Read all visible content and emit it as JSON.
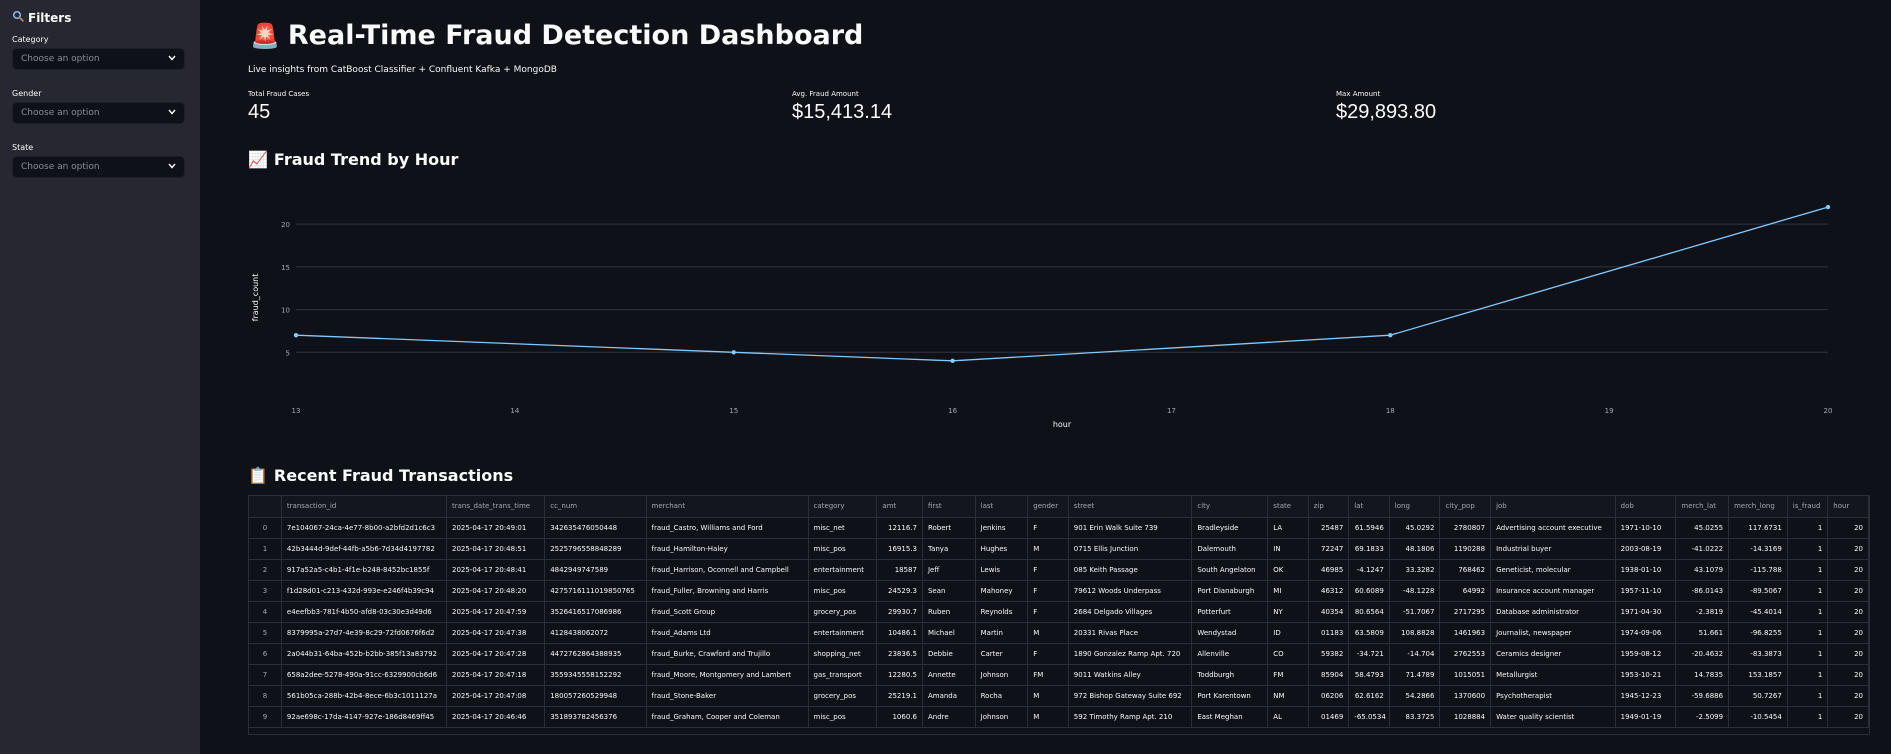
{
  "sidebar": {
    "title": "Filters",
    "title_icon": "magnifier-icon",
    "filters": [
      {
        "label": "Category",
        "placeholder": "Choose an option"
      },
      {
        "label": "Gender",
        "placeholder": "Choose an option"
      },
      {
        "label": "State",
        "placeholder": "Choose an option"
      }
    ]
  },
  "header": {
    "title": "Real-Time Fraud Detection Dashboard",
    "title_icon": "🚨",
    "subtitle": "Live insights from CatBoost Classifier + Confluent Kafka + MongoDB"
  },
  "metrics": [
    {
      "label": "Total Fraud Cases",
      "value": "45"
    },
    {
      "label": "Avg. Fraud Amount",
      "value": "$15,413.14"
    },
    {
      "label": "Max Amount",
      "value": "$29,893.80"
    }
  ],
  "trend_section": {
    "title": "Fraud Trend by Hour",
    "icon": "📈"
  },
  "chart_data": {
    "type": "line",
    "x": [
      13,
      16,
      15,
      18,
      20
    ],
    "y": [
      7,
      4,
      5,
      7,
      22
    ],
    "xticks": [
      "13",
      "14",
      "15",
      "16",
      "17",
      "18",
      "19",
      "20"
    ],
    "yticks": [
      "5",
      "10",
      "15",
      "20"
    ],
    "xlabel": "hour",
    "ylabel": "fraud_count",
    "xlim": [
      13,
      20
    ],
    "ylim": [
      0,
      24
    ],
    "grid": true,
    "line_color": "#83c9ff"
  },
  "table_section": {
    "title": "Recent Fraud Transactions",
    "icon": "📋"
  },
  "table": {
    "columns": [
      "",
      "transaction_id",
      "trans_date_trans_time",
      "cc_num",
      "merchant",
      "category",
      "amt",
      "first",
      "last",
      "gender",
      "street",
      "city",
      "state",
      "zip",
      "lat",
      "long",
      "city_pop",
      "job",
      "dob",
      "merch_lat",
      "merch_long",
      "is_fraud",
      "hour"
    ],
    "rows": [
      [
        "0",
        "7e104067-24ca-4e77-8b00-a2bfd2d1c6c3",
        "2025-04-17 20:49:01",
        "342635476050448",
        "fraud_Castro, Williams and Ford",
        "misc_net",
        "12116.7",
        "Robert",
        "Jenkins",
        "F",
        "901 Erin Walk Suite 739",
        "Bradleyside",
        "LA",
        "25487",
        "61.5946",
        "45.0292",
        "2780807",
        "Advertising account executive",
        "1971-10-10",
        "45.0255",
        "117.6731",
        "1",
        "20"
      ],
      [
        "1",
        "42b3444d-9def-44fb-a5b6-7d34d4197782",
        "2025-04-17 20:48:51",
        "2525796558848289",
        "fraud_Hamilton-Haley",
        "misc_pos",
        "16915.3",
        "Tanya",
        "Hughes",
        "M",
        "0715 Ellis Junction",
        "Dalemouth",
        "IN",
        "72247",
        "69.1833",
        "48.1806",
        "1190288",
        "Industrial buyer",
        "2003-08-19",
        "-41.0222",
        "-14.3169",
        "1",
        "20"
      ],
      [
        "2",
        "917a52a5-c4b1-4f1e-b248-8452bc1855f",
        "2025-04-17 20:48:41",
        "4842949747589",
        "fraud_Harrison, Oconnell and Campbell",
        "entertainment",
        "18587",
        "Jeff",
        "Lewis",
        "F",
        "085 Keith Passage",
        "South Angelaton",
        "OK",
        "46985",
        "-4.1247",
        "33.3282",
        "768462",
        "Geneticist, molecular",
        "1938-01-10",
        "43.1079",
        "-115.788",
        "1",
        "20"
      ],
      [
        "3",
        "f1d28d01-c213-432d-993e-e246f4b39c94",
        "2025-04-17 20:48:20",
        "4275716111019850765",
        "fraud_Fuller, Browning and Harris",
        "misc_pos",
        "24529.3",
        "Sean",
        "Mahoney",
        "F",
        "79612 Woods Underpass",
        "Port Dianaburgh",
        "MI",
        "46312",
        "60.6089",
        "-48.1228",
        "64992",
        "Insurance account manager",
        "1957-11-10",
        "-86.0143",
        "-89.5067",
        "1",
        "20"
      ],
      [
        "4",
        "e4eefbb3-781f-4b50-afd8-03c30e3d49d6",
        "2025-04-17 20:47:59",
        "3526416517086986",
        "fraud_Scott Group",
        "grocery_pos",
        "29930.7",
        "Ruben",
        "Reynolds",
        "F",
        "2684 Delgado Villages",
        "Potterfurt",
        "NY",
        "40354",
        "80.6564",
        "-51.7067",
        "2717295",
        "Database administrator",
        "1971-04-30",
        "-2.3819",
        "-45.4014",
        "1",
        "20"
      ],
      [
        "5",
        "8379995a-27d7-4e39-8c29-72fd0676f6d2",
        "2025-04-17 20:47:38",
        "4128438062072",
        "fraud_Adams Ltd",
        "entertainment",
        "10486.1",
        "Michael",
        "Martin",
        "M",
        "20331 Rivas Place",
        "Wendystad",
        "ID",
        "01183",
        "63.5809",
        "108.8828",
        "1461963",
        "Journalist, newspaper",
        "1974-09-06",
        "51.661",
        "-96.8255",
        "1",
        "20"
      ],
      [
        "6",
        "2a044b31-64ba-452b-b2bb-385f13a83792",
        "2025-04-17 20:47:28",
        "4472762864388935",
        "fraud_Burke, Crawford and Trujillo",
        "shopping_net",
        "23836.5",
        "Debbie",
        "Carter",
        "F",
        "1890 Gonzalez Ramp Apt. 720",
        "Allenville",
        "CO",
        "59382",
        "-34.721",
        "-14.704",
        "2762553",
        "Ceramics designer",
        "1959-08-12",
        "-20.4632",
        "-83.3873",
        "1",
        "20"
      ],
      [
        "7",
        "658a2dee-5278-490a-91cc-6329900cb6d6",
        "2025-04-17 20:47:18",
        "3559345558152292",
        "fraud_Moore, Montgomery and Lambert",
        "gas_transport",
        "12280.5",
        "Annette",
        "Johnson",
        "FM",
        "9011 Watkins Alley",
        "Toddburgh",
        "FM",
        "85904",
        "58.4793",
        "71.4789",
        "1015051",
        "Metallurgist",
        "1953-10-21",
        "14.7835",
        "153.1857",
        "1",
        "20"
      ],
      [
        "8",
        "561b05ca-288b-42b4-8ece-6b3c1011127a",
        "2025-04-17 20:47:08",
        "180057260529948",
        "fraud_Stone-Baker",
        "grocery_pos",
        "25219.1",
        "Amanda",
        "Rocha",
        "M",
        "972 Bishop Gateway Suite 692",
        "Port Karentown",
        "NM",
        "06206",
        "62.6162",
        "54.2866",
        "1370600",
        "Psychotherapist",
        "1945-12-23",
        "-59.6886",
        "50.7267",
        "1",
        "20"
      ],
      [
        "9",
        "92ae698c-17da-4147-927e-186d8469ff45",
        "2025-04-17 20:46:46",
        "351893782456376",
        "fraud_Graham, Cooper and Coleman",
        "misc_pos",
        "1060.6",
        "Andre",
        "Johnson",
        "M",
        "592 Timothy Ramp Apt. 210",
        "East Meghan",
        "AL",
        "01469",
        "-65.0534",
        "83.3725",
        "1028884",
        "Water quality scientist",
        "1949-01-19",
        "-2.5099",
        "-10.5454",
        "1",
        "20"
      ]
    ]
  }
}
